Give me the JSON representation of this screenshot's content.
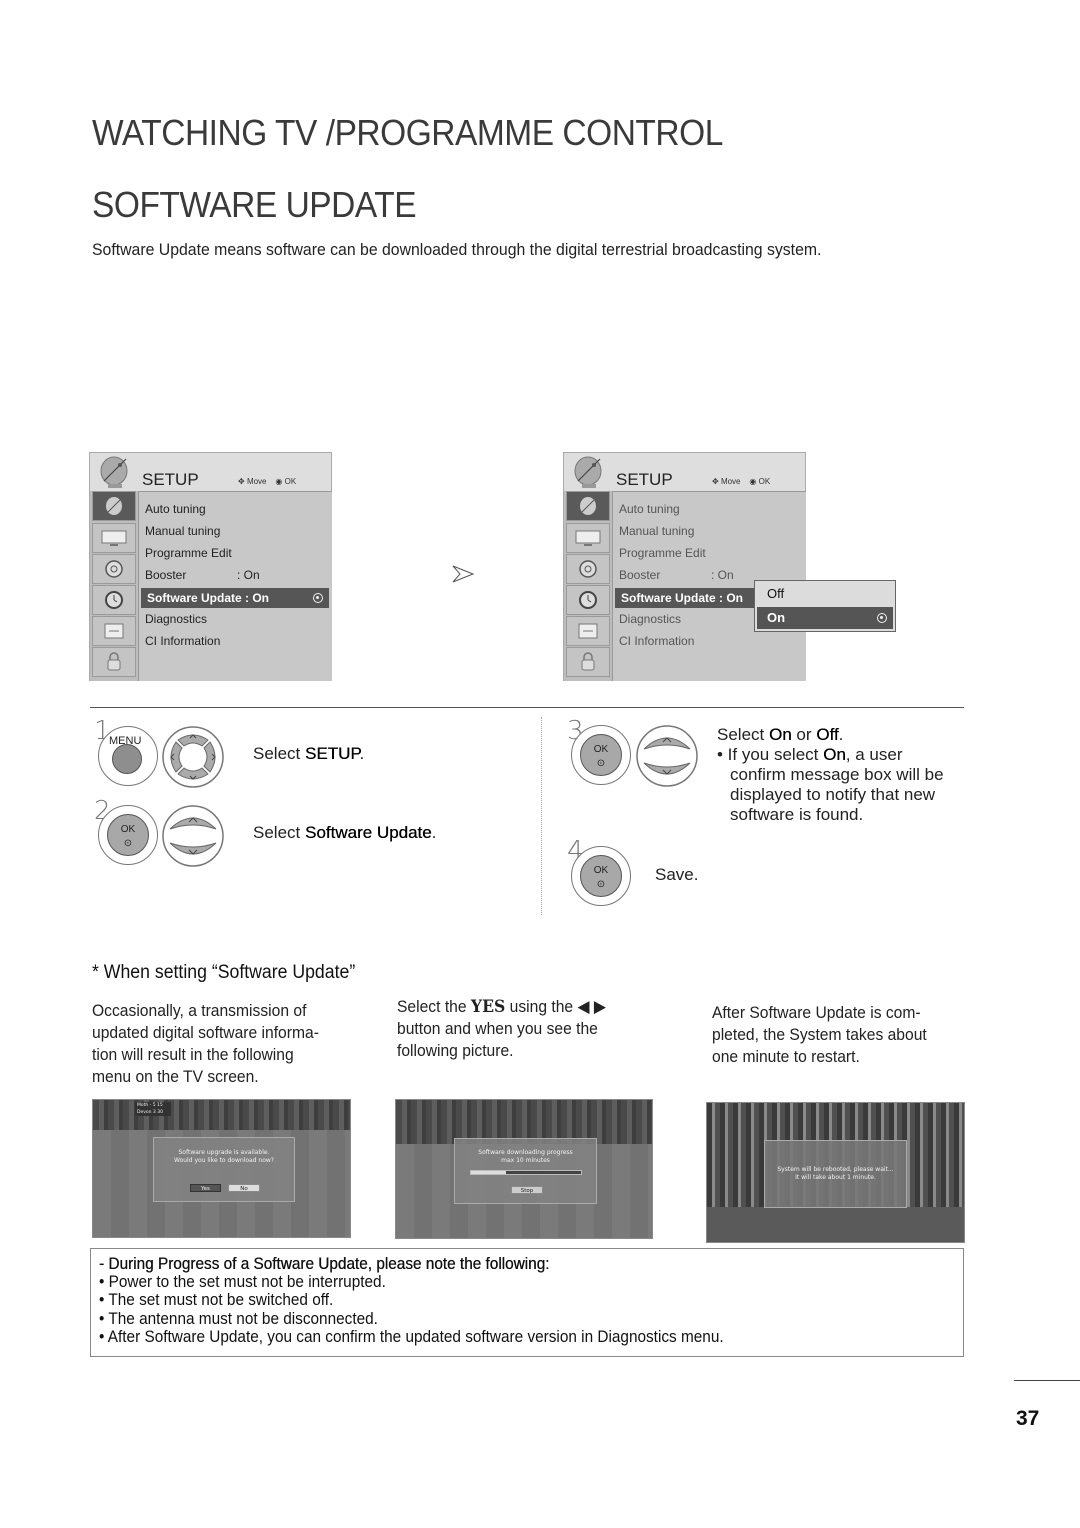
{
  "header": {
    "section_title": "WATCHING TV /PROGRAMME CONTROL",
    "page_title": "SOFTWARE UPDATE",
    "intro": "Software Update means software can be downloaded through the digital terrestrial broadcasting system."
  },
  "menu_left": {
    "title": "SETUP",
    "hint_move": "Move",
    "hint_ok": "OK",
    "sidebar_icons": [
      "satellite-dish-icon",
      "tv-screen-icon",
      "speaker-icon",
      "clock-icon",
      "lock-panel-icon",
      "padlock-icon"
    ],
    "items": [
      {
        "label": "Auto tuning",
        "value": ""
      },
      {
        "label": "Manual tuning",
        "value": ""
      },
      {
        "label": "Programme Edit",
        "value": ""
      },
      {
        "label": "Booster",
        "value": ": On"
      },
      {
        "label": "Software Update : On",
        "value": ""
      },
      {
        "label": "Diagnostics",
        "value": ""
      },
      {
        "label": "CI Information",
        "value": ""
      }
    ],
    "selected_index": 4
  },
  "menu_right": {
    "title": "SETUP",
    "hint_move": "Move",
    "hint_ok": "OK",
    "items": [
      {
        "label": "Auto tuning",
        "value": ""
      },
      {
        "label": "Manual tuning",
        "value": ""
      },
      {
        "label": "Programme Edit",
        "value": ""
      },
      {
        "label": "Booster",
        "value": ": On"
      },
      {
        "label": "Software Update : On",
        "value": ""
      },
      {
        "label": "Diagnostics",
        "value": ""
      },
      {
        "label": "CI Information",
        "value": ""
      }
    ],
    "selected_index": 4,
    "popup": {
      "options": [
        "Off",
        "On"
      ],
      "selected": "On"
    }
  },
  "steps": [
    {
      "num": "1",
      "button": "MENU",
      "text_pre": "Select ",
      "text_bold": "SETUP",
      "text_post": "."
    },
    {
      "num": "2",
      "button": "OK",
      "text_pre": "Select ",
      "text_bold": "Software Update",
      "text_post": "."
    },
    {
      "num": "3",
      "button": "OK",
      "line1_pre": "Select ",
      "line1_b1": "On",
      "line1_mid": " or ",
      "line1_b2": "Off",
      "line1_post": ".",
      "bullet_pre": "• If you select ",
      "bullet_bold": "On",
      "bullet_post": ", a user",
      "lines": [
        "confirm message box will be",
        "displayed to notify that new",
        "software is found."
      ]
    },
    {
      "num": "4",
      "button": "OK",
      "text": "Save."
    }
  ],
  "when_setting": {
    "heading": "* When setting “Software Update”",
    "columns": [
      {
        "lines": [
          "Occasionally, a transmission of",
          "updated digital software informa-",
          "tion will result in the following",
          "menu on the TV screen."
        ]
      },
      {
        "line1_pre": "Select the ",
        "line1_bold": "YES",
        "line1_post": " using the ◀ ▶",
        "lines": [
          "button and when you see the",
          "following picture."
        ]
      },
      {
        "lines": [
          "After Software Update is com-",
          "pleted, the System takes about",
          "one minute to restart."
        ]
      }
    ],
    "screens": [
      {
        "scoreboard": [
          "Moth  -  5  15",
          "Devon  3  30"
        ],
        "message": [
          "Software upgrade is available.",
          "Would you like to download now?"
        ],
        "buttons": [
          "Yes",
          "No"
        ]
      },
      {
        "message": [
          "Software downloading progress",
          "max 10 minutes"
        ],
        "progress": 0.32,
        "buttons": [
          "Stop"
        ]
      },
      {
        "message": [
          "System will be rebooted, please wait...",
          "It will take about 1 minute."
        ]
      }
    ]
  },
  "notes": {
    "heading": "- During Progress of a Software Update, please note the following:",
    "items": [
      "• Power to the set must not be interrupted.",
      "• The set must not be switched off.",
      "• The antenna must not be disconnected.",
      "• After Software Update, you can confirm the updated software version in Diagnostics menu."
    ]
  },
  "page_number": "37"
}
